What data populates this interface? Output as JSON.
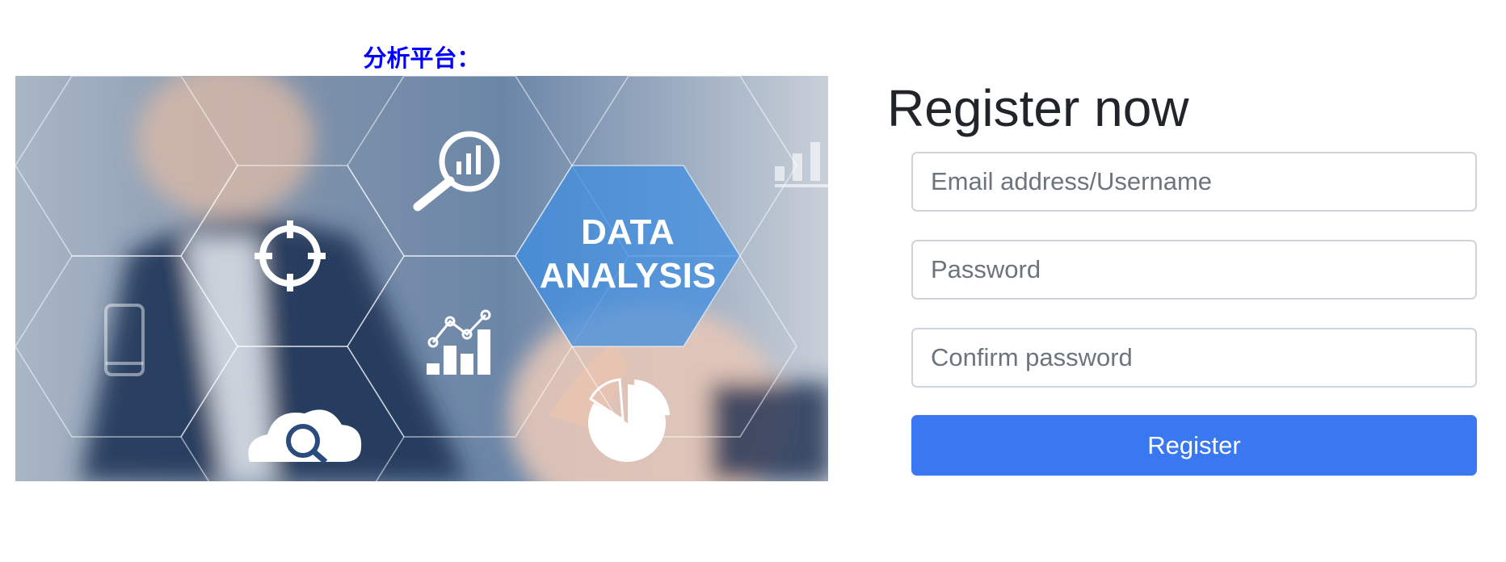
{
  "platform": {
    "title": "分析平台："
  },
  "hero": {
    "headline_line1": "DATA",
    "headline_line2": "ANALYSIS"
  },
  "register": {
    "heading": "Register now",
    "email_placeholder": "Email address/Username",
    "password_placeholder": "Password",
    "confirm_placeholder": "Confirm password",
    "submit_label": "Register"
  },
  "colors": {
    "title_blue": "#0000ff",
    "button_blue": "#3a78f2",
    "hexagon_highlight": "#3f8de0",
    "input_border": "#ced4da"
  },
  "icons": [
    "magnifier-chart-icon",
    "crosshair-icon",
    "line-bar-chart-icon",
    "cloud-search-icon",
    "pie-chart-icon",
    "smartphone-icon",
    "bar-chart-icon"
  ]
}
